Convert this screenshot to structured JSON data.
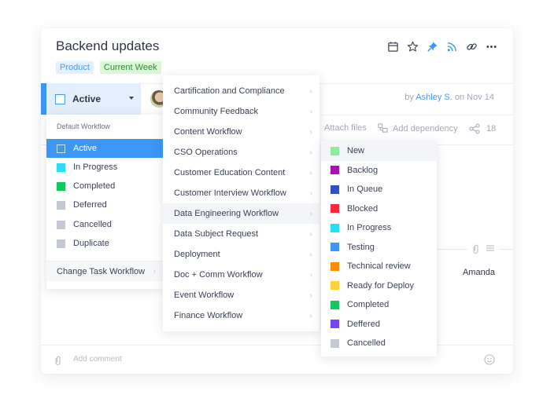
{
  "task": {
    "title": "Backend updates",
    "tags": [
      {
        "label": "Product",
        "color": "#4a9af4"
      },
      {
        "label": "Current Week",
        "color": "#2f8a3c"
      }
    ],
    "toolbar_icons": [
      "calendar-icon",
      "star-icon",
      "pin-icon",
      "rss-icon",
      "link-icon",
      "more-icon"
    ],
    "status": {
      "label": "Active"
    },
    "byline": {
      "prefix": "by",
      "author": "Ashley S.",
      "suffix": "on Nov 14"
    },
    "actions": {
      "attach": "Attach files",
      "dependency": "Add dependency",
      "share_count": "18"
    },
    "assignee": "Amanda",
    "comment_placeholder": "Add comment"
  },
  "status_menu": {
    "header": "Default Workflow",
    "items": [
      {
        "label": "Active",
        "color": "",
        "selected": true
      },
      {
        "label": "In Progress",
        "color": "#26e0f6"
      },
      {
        "label": "Completed",
        "color": "#15c65d"
      },
      {
        "label": "Deferred",
        "color": "#c3c8d4"
      },
      {
        "label": "Cancelled",
        "color": "#c3c8d4"
      },
      {
        "label": "Duplicate",
        "color": "#c3c8d4"
      }
    ],
    "footer": "Change Task Workflow"
  },
  "workflow_menu": {
    "items": [
      "Cartification and Compliance",
      "Community Feedback",
      "Content Workflow",
      "CSO Operations",
      "Customer Education Content",
      "Customer Interview Workflow",
      "Data Engineering Workflow",
      "Data Subject Request",
      "Deployment",
      "Doc + Comm Workflow",
      "Event Workflow",
      "Finance Workflow"
    ],
    "hovered": "Data Engineering Workflow"
  },
  "data_eng_statuses": {
    "items": [
      {
        "label": "New",
        "color": "#8eed9a"
      },
      {
        "label": "Backlog",
        "color": "#ab12b4"
      },
      {
        "label": "In Queue",
        "color": "#3451bf"
      },
      {
        "label": "Blocked",
        "color": "#f5283f"
      },
      {
        "label": "In Progress",
        "color": "#26e0f6"
      },
      {
        "label": "Testing",
        "color": "#3c96f6"
      },
      {
        "label": "Technical review",
        "color": "#fb8a0e"
      },
      {
        "label": "Ready for Deploy",
        "color": "#ffd03d"
      },
      {
        "label": "Completed",
        "color": "#15c65d"
      },
      {
        "label": "Deffered",
        "color": "#7444f5"
      },
      {
        "label": "Cancelled",
        "color": "#c3c8d4"
      }
    ]
  }
}
